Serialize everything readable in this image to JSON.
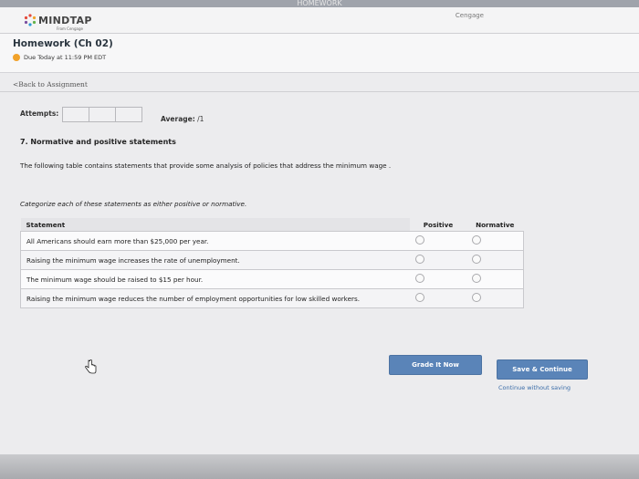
{
  "top_strip_text": "HOMEWORK",
  "header": {
    "logo_text": "MINDTAP",
    "logo_sub": "From Cengage",
    "brand": "Cengage"
  },
  "course": {
    "title": "Homework (Ch 02)",
    "due": "Due Today at 11:59 PM EDT"
  },
  "back_link": "<Back to Assignment",
  "attempts": {
    "label": "Attempts:",
    "average_label": "Average:",
    "average_value": "/1"
  },
  "question": {
    "title": "7. Normative and positive statements",
    "description": "The following table contains statements that provide some analysis of policies that address the minimum wage .",
    "instruction": "Categorize each of these statements as either positive or normative."
  },
  "table": {
    "headers": {
      "statement": "Statement",
      "positive": "Positive",
      "normative": "Normative"
    },
    "rows": [
      {
        "statement": "All Americans should earn more than $25,000 per year."
      },
      {
        "statement": "Raising the minimum wage increases the rate of unemployment."
      },
      {
        "statement": "The minimum wage should be raised to $15 per hour."
      },
      {
        "statement": "Raising the minimum wage reduces the number of employment opportunities for low skilled workers."
      }
    ]
  },
  "buttons": {
    "grade": "Grade It Now",
    "save": "Save & Continue",
    "continue_without": "Continue without saving"
  },
  "colors": {
    "button_blue": "#5a84b8",
    "due_dot": "#f1a22a",
    "link_blue": "#3a6ca8"
  }
}
